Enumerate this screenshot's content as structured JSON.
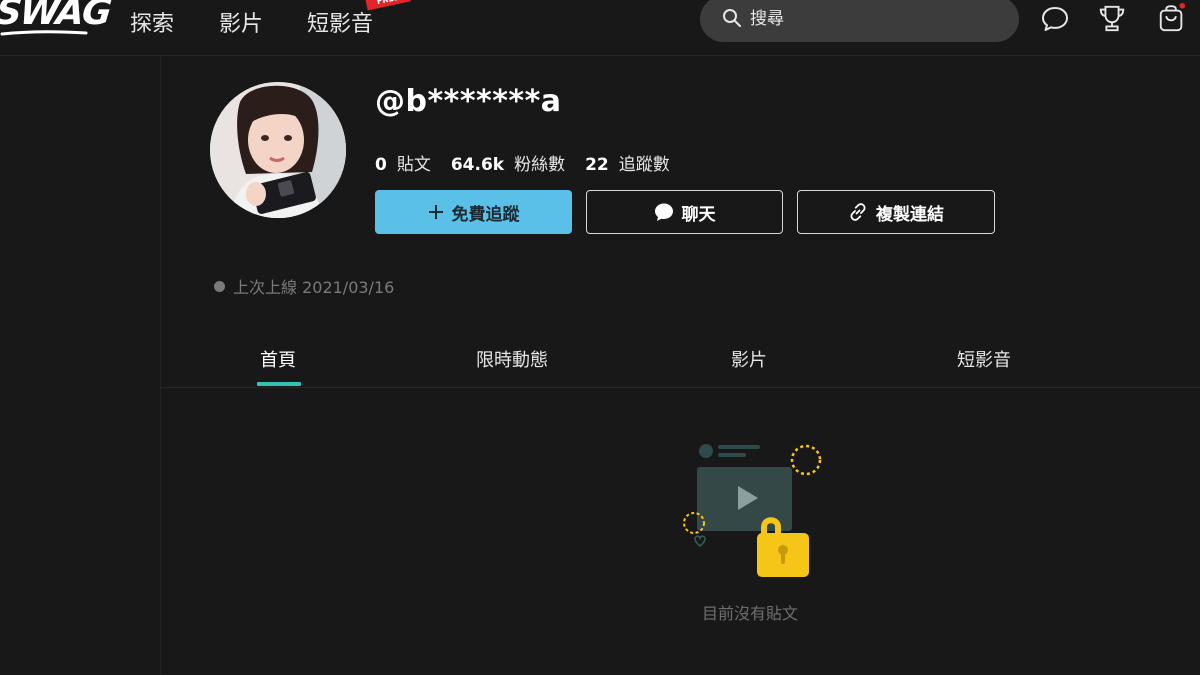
{
  "header": {
    "logo": "SWAG",
    "nav": [
      "探索",
      "影片",
      "短影音"
    ],
    "badge": "FREE",
    "search": {
      "placeholder": "搜尋"
    },
    "icons": [
      "chat-bubble-icon",
      "trophy-icon",
      "bag-icon"
    ]
  },
  "profile": {
    "username": "@b*******a",
    "stats": [
      {
        "value": "0",
        "label": "貼文"
      },
      {
        "value": "64.6k",
        "label": "粉絲數"
      },
      {
        "value": "22",
        "label": "追蹤數"
      }
    ],
    "buttons": {
      "follow": "免費追蹤",
      "chat": "聊天",
      "copy_link": "複製連結"
    },
    "last_online": "上次上線 2021/03/16"
  },
  "tabs": {
    "items": [
      "首頁",
      "限時動態",
      "影片",
      "短影音"
    ],
    "active_index": 0
  },
  "empty_state": {
    "message": "目前沒有貼文"
  },
  "colors": {
    "background": "#181818",
    "accent_follow": "#5bc0e8",
    "tab_underline": "#2ec4b6",
    "lock": "#f5c518",
    "notification_dot": "#e0262a"
  }
}
